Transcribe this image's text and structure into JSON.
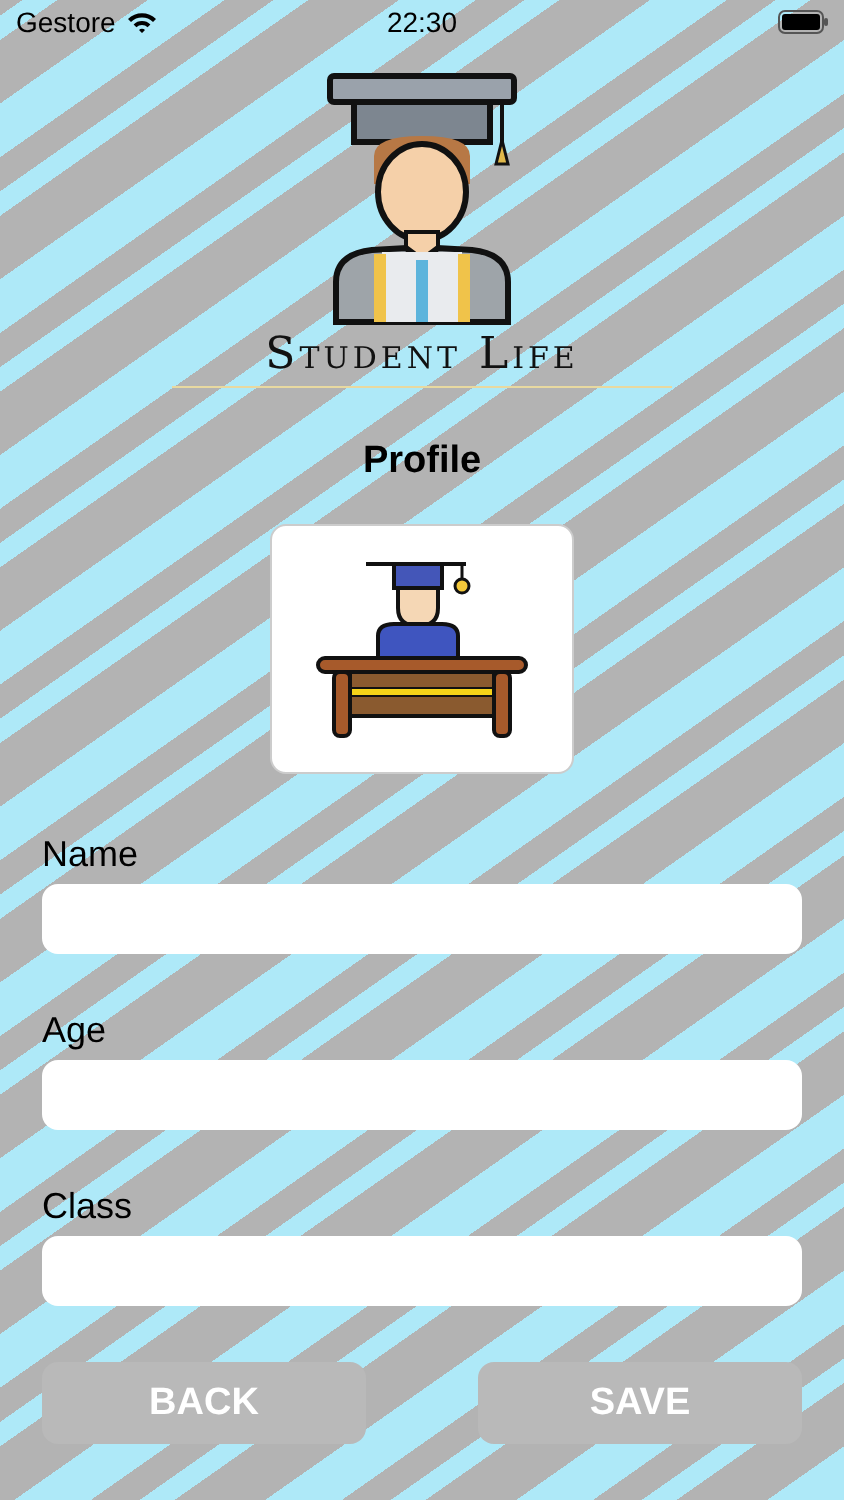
{
  "status_bar": {
    "carrier": "Gestore",
    "time": "22:30"
  },
  "logo": {
    "title": "Student Life"
  },
  "title": "Profile",
  "fields": [
    {
      "label": "Name"
    },
    {
      "label": "Age"
    },
    {
      "label": "Class"
    }
  ],
  "buttons": [
    {
      "label": "BACK"
    },
    {
      "label": "SAVE"
    }
  ]
}
